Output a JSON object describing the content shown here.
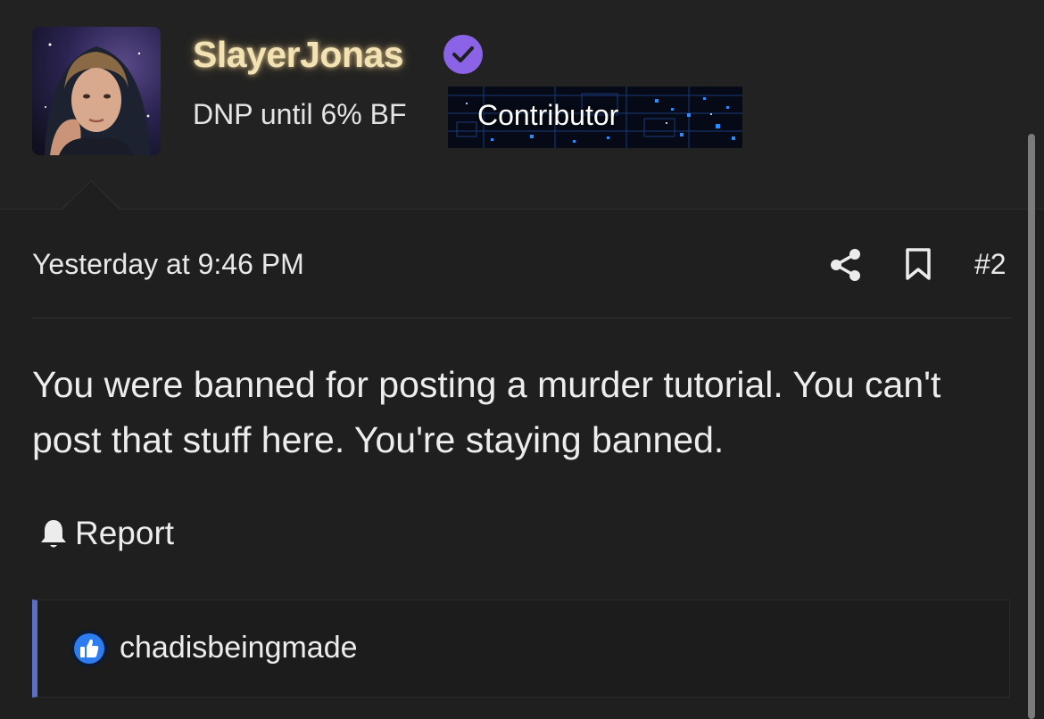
{
  "user": {
    "name": "SlayerJonas",
    "title": "DNP until 6% BF",
    "badge": "Contributor",
    "verified_color": "#8a63e6",
    "name_color": "#f3e2b4"
  },
  "post": {
    "timestamp": "Yesterday at 9:46 PM",
    "number": "#2",
    "message": "You were banned for posting a murder tutorial. You can't post that stuff here. You're staying banned.",
    "report_label": "Report"
  },
  "icons": {
    "verified": "verified-check-icon",
    "share": "share-icon",
    "bookmark": "bookmark-icon",
    "report": "bell-icon",
    "reaction": "thumbs-up-icon"
  },
  "reactions": {
    "user": "chadisbeingmade",
    "accent_color": "#5b6fc4",
    "like_color": "#2d7cf0"
  }
}
